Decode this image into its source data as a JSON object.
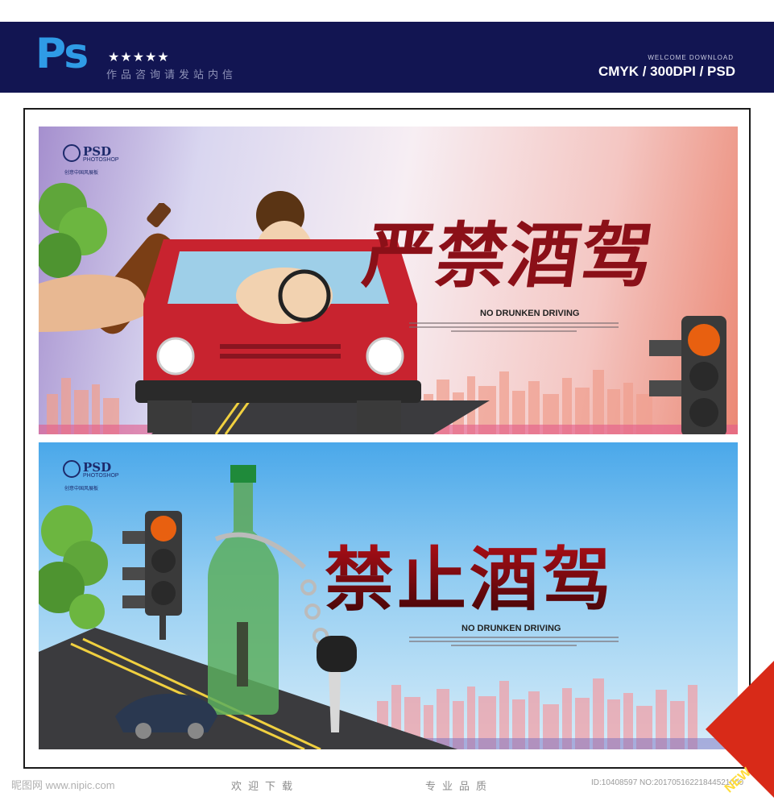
{
  "header": {
    "logo": "Ps",
    "stars": "★★★★★",
    "tagline": "作品咨询请发站内信",
    "welcome": "WELCOME DOWNLOAD",
    "specs": "CMYK / 300DPI / PSD"
  },
  "banner1": {
    "psd_logo": "PSD",
    "psd_sub": "PHOTOSHOP",
    "psd_small": "创意中国风展板",
    "title": "严禁酒驾",
    "subtitle": "NO DRUNKEN DRIVING"
  },
  "banner2": {
    "psd_logo": "PSD",
    "psd_sub": "PHOTOSHOP",
    "psd_small": "创意中国风展板",
    "title": "禁止酒驾",
    "subtitle": "NO DRUNKEN DRIVING"
  },
  "footer": {
    "watermark": "昵图网 www.nipic.com",
    "left_text": "欢迎下载",
    "right_text": "专业品质",
    "image_id": "ID:10408597 NO:20170516221844521000",
    "new_badge": "NEW"
  },
  "colors": {
    "header_bg": "#121552",
    "ps_blue": "#2f9be6",
    "title_red": "#8b1018"
  }
}
